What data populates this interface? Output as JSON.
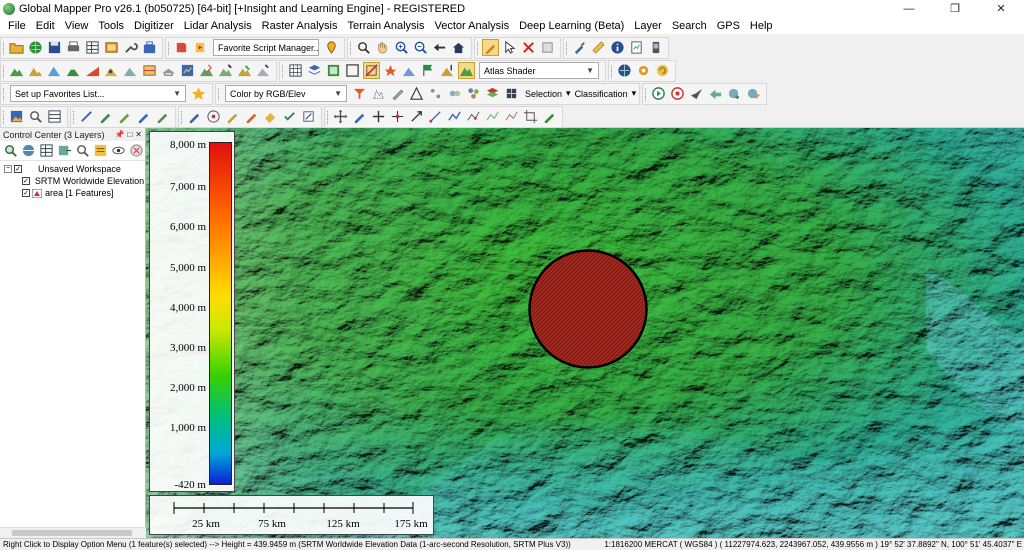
{
  "window": {
    "title": "Global Mapper Pro v26.1 (b050725) [64-bit] [+Insight and Learning Engine] - REGISTERED",
    "minimize": "—",
    "maximize": "❐",
    "close": "✕"
  },
  "menu": {
    "items": [
      "File",
      "Edit",
      "View",
      "Tools",
      "Digitizer",
      "Lidar Analysis",
      "Raster Analysis",
      "Terrain Analysis",
      "Vector Analysis",
      "Deep Learning (Beta)",
      "Layer",
      "Search",
      "GPS",
      "Help"
    ]
  },
  "toolbar": {
    "script_dropdown": "Favorite Script Manager...",
    "shader_dropdown": "Atlas Shader",
    "favorites_dropdown": "Set up Favorites List...",
    "color_dropdown": "Color by RGB/Elev",
    "selection_label": "Selection",
    "classification_label": "Classification"
  },
  "control_center": {
    "title": "Control Center (3 Layers)",
    "workspace": "Unsaved Workspace",
    "layers": [
      "SRTM Worldwide Elevation Data",
      "area [1 Features]"
    ]
  },
  "legend": {
    "labels": [
      "8,000 m",
      "7,000 m",
      "6,000 m",
      "5,000 m",
      "4,000 m",
      "3,000 m",
      "2,000 m",
      "1,000 m",
      "-420 m"
    ]
  },
  "scalebar": {
    "labels": [
      "25 km",
      "75 km",
      "125 km",
      "175 km"
    ]
  },
  "status": {
    "left": "Right Click to Display Option Menu (1 feature(s) selected) --> Height = 439.9459 m (SRTM Worldwide Elevation Data (1-arc-second Resolution, SRTM Plus V3))",
    "right": "1:1816200  MERCAT ( WGS84 ) ( 11227974.623, 2243967.052, 439.9556 m )  19° 52' 37.8892\" N, 100° 51' 45.4037\" E"
  },
  "colors": {
    "feature_fill": "#8b1c14",
    "feature_stroke": "#000000"
  },
  "icons": {
    "row1": [
      "open-folder-icon",
      "globe-icon",
      "save-icon",
      "print-icon",
      "table-icon",
      "config-icon",
      "wrench-icon",
      "toolbox-icon",
      "script-icon",
      "run-script-icon",
      "map-pin-icon",
      "pan-icon",
      "zoom-in-icon",
      "zoom-out-icon",
      "back-icon",
      "home-icon",
      "digitize-icon",
      "select-icon",
      "delete-icon",
      "edit-icon",
      "brush-icon",
      "ruler-icon",
      "info-icon",
      "gps-device-icon"
    ],
    "row2": [
      "terrain-icon",
      "contour-icon",
      "watershed-icon",
      "peak-icon",
      "slope-icon",
      "viewshed-icon",
      "hillshade-icon",
      "cross-section-icon",
      "volume-icon",
      "lidar-icon",
      "classify-icon",
      "grid-icon",
      "layers-icon",
      "flag-icon",
      "3d-icon",
      "shader-icon",
      "settings-icon",
      "refresh-icon"
    ]
  }
}
